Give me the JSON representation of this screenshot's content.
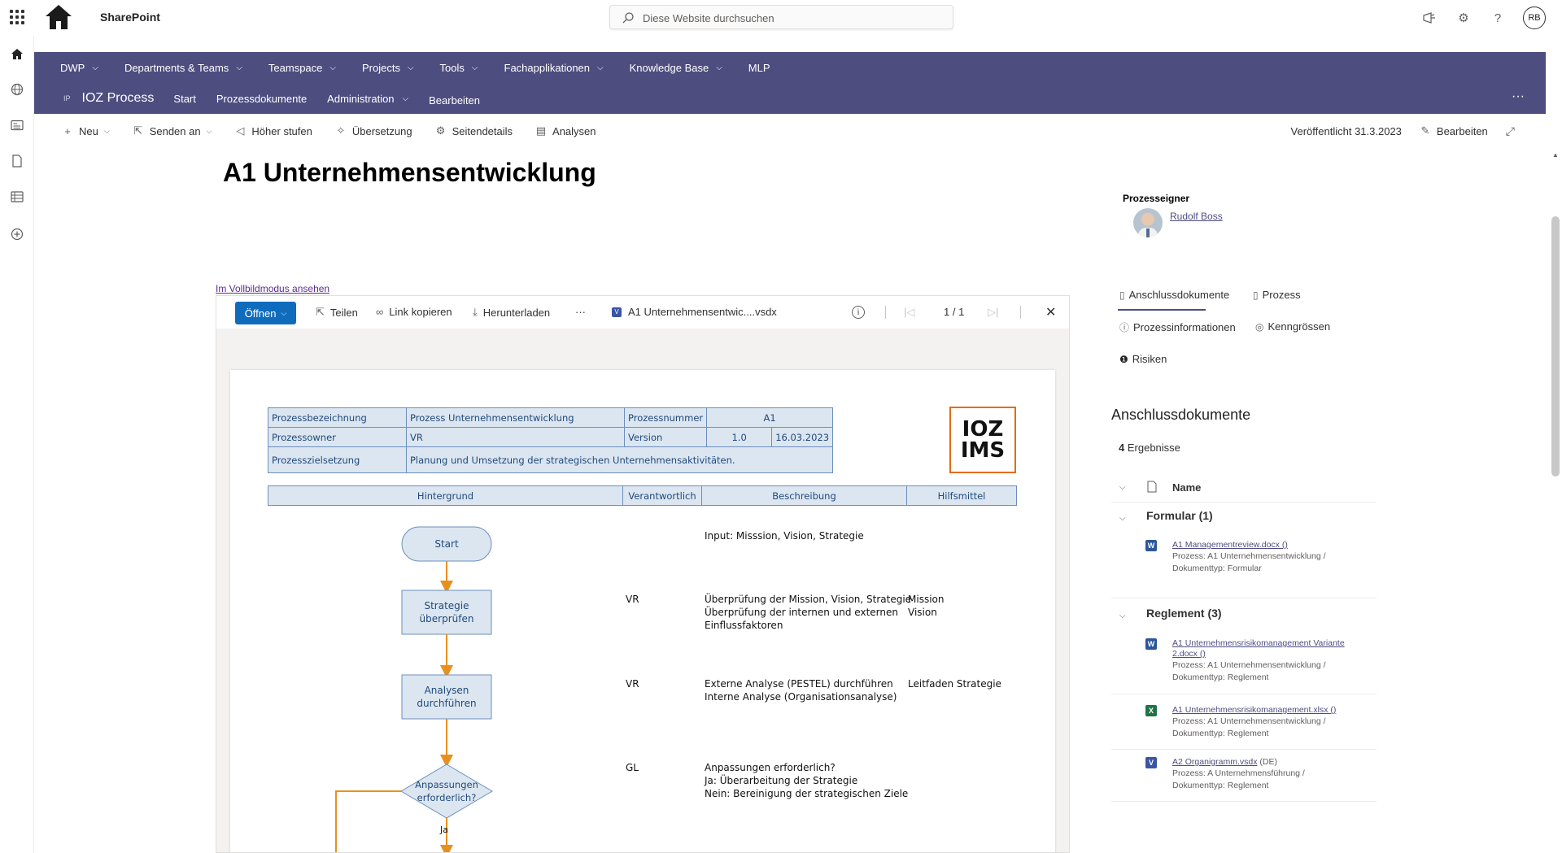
{
  "suite": {
    "brand": "SharePoint",
    "search_placeholder": "Diese Website durchsuchen",
    "avatar_initials": "RB"
  },
  "hub_nav": [
    {
      "label": "DWP",
      "has_menu": true
    },
    {
      "label": "Departments & Teams",
      "has_menu": true
    },
    {
      "label": "Teamspace",
      "has_menu": true
    },
    {
      "label": "Projects",
      "has_menu": true
    },
    {
      "label": "Tools",
      "has_menu": true
    },
    {
      "label": "Fachapplikationen",
      "has_menu": true
    },
    {
      "label": "Knowledge Base",
      "has_menu": true
    },
    {
      "label": "MLP",
      "has_menu": false
    }
  ],
  "site": {
    "logo_text": "IP",
    "title": "IOZ Process",
    "nav": [
      {
        "label": "Start",
        "has_menu": false
      },
      {
        "label": "Prozessdokumente",
        "has_menu": false
      },
      {
        "label": "Administration",
        "has_menu": true
      },
      {
        "label": "Bearbeiten",
        "has_menu": false
      }
    ]
  },
  "command_bar": {
    "items": [
      {
        "label": "Neu",
        "icon": "plus-icon",
        "has_menu": true
      },
      {
        "label": "Senden an",
        "icon": "share-icon",
        "has_menu": true
      },
      {
        "label": "Höher stufen",
        "icon": "megaphone-icon",
        "has_menu": false
      },
      {
        "label": "Übersetzung",
        "icon": "translate-icon",
        "has_menu": false
      },
      {
        "label": "Seitendetails",
        "icon": "gear-icon",
        "has_menu": false
      },
      {
        "label": "Analysen",
        "icon": "chart-icon",
        "has_menu": false
      }
    ],
    "published": "Veröffentlicht 31.3.2023",
    "edit_label": "Bearbeiten"
  },
  "page": {
    "title": "A1 Unternehmensentwicklung",
    "owner_label": "Prozesseigner",
    "owner_name": "Rudolf Boss",
    "fullscreen_link": "Im Vollbildmodus ansehen"
  },
  "viewer": {
    "open_label": "Öffnen",
    "share_label": "Teilen",
    "copy_link_label": "Link kopieren",
    "download_label": "Herunterladen",
    "more_label": "···",
    "file_name": "A1 Unternehmensentwic....vsdx",
    "page_indicator": "1 / 1"
  },
  "document": {
    "header_rows": {
      "name_label": "Prozessbezeichnung",
      "name_value": "Prozess Unternehmensentwicklung",
      "number_label": "Prozessnummer",
      "number_value": "A1",
      "owner_label": "Prozessowner",
      "owner_value": "VR",
      "version_label": "Version",
      "version_value": "1.0",
      "version_date": "16.03.2023",
      "goal_label": "Prozesszielsetzung",
      "goal_value": "Planung und Umsetzung der strategischen Unternehmensaktivitäten."
    },
    "columns": [
      "Hintergrund",
      "Verantwortlich",
      "Beschreibung",
      "Hilfsmittel"
    ],
    "logo_line1": "IOZ",
    "logo_line2": "IMS",
    "steps": [
      {
        "node": "Start",
        "responsible": "",
        "description": "Input: Misssion, Vision, Strategie",
        "tools": ""
      },
      {
        "node": "Strategie\nüberprüfen",
        "responsible": "VR",
        "description": "Überprüfung der Mission, Vision, Strategie\nÜberprüfung der internen und externen\nEinflussfaktoren",
        "tools": "Mission\nVision"
      },
      {
        "node": "Analysen\ndurchführen",
        "responsible": "VR",
        "description": "Externe Analyse (PESTEL) durchführen\nInterne Analyse (Organisationsanalyse)",
        "tools": "Leitfaden Strategie"
      },
      {
        "node": "Anpassungen\nerforderlich?",
        "responsible": "GL",
        "description": "Anpassungen erforderlich?\nJa: Überarbeitung der Strategie\nNein: Bereinigung der strategischen Ziele",
        "tools": ""
      }
    ],
    "yes_label": "Ja"
  },
  "panel": {
    "tabs": [
      {
        "label": "Anschlussdokumente",
        "icon": "document-icon",
        "active": true
      },
      {
        "label": "Prozess",
        "icon": "page-icon",
        "active": false
      },
      {
        "label": "Prozessinformationen",
        "icon": "info-icon",
        "active": false
      },
      {
        "label": "Kenngrössen",
        "icon": "target-icon",
        "active": false
      },
      {
        "label": "Risiken",
        "icon": "alert-icon",
        "active": false
      }
    ],
    "section_title": "Anschlussdokumente",
    "results_count": "4",
    "results_label": "Ergebnisse",
    "name_header": "Name",
    "groups": [
      {
        "title": "Formular (1)",
        "items": [
          {
            "type": "word",
            "link": "A1 Managementreview.docx ()",
            "meta": "Prozess: A1 Unternehmensentwicklung /\nDokumenttyp: Formular"
          }
        ]
      },
      {
        "title": "Reglement (3)",
        "items": [
          {
            "type": "word",
            "link": "A1 Unternehmensrisikomanagement Variante 2.docx ()",
            "meta": "Prozess: A1 Unternehmensentwicklung /\nDokumenttyp: Reglement"
          },
          {
            "type": "excel",
            "link": "A1 Unternehmensrisikomanagement.xlsx ()",
            "meta": "Prozess: A1 Unternehmensentwicklung /\nDokumenttyp: Reglement"
          },
          {
            "type": "visio",
            "link": "A2 Organigramm.vsdx",
            "link_suffix": " (DE)",
            "meta": "Prozess: A Unternehmensführung /\nDokumenttyp: Reglement"
          }
        ]
      }
    ]
  },
  "colors": {
    "hub_bg": "#4d4d80",
    "primary_button": "#0f6cbd",
    "flow_arrow": "#e8901e",
    "node_fill": "#dce6f0",
    "logo_accent": "#e46c0a"
  }
}
